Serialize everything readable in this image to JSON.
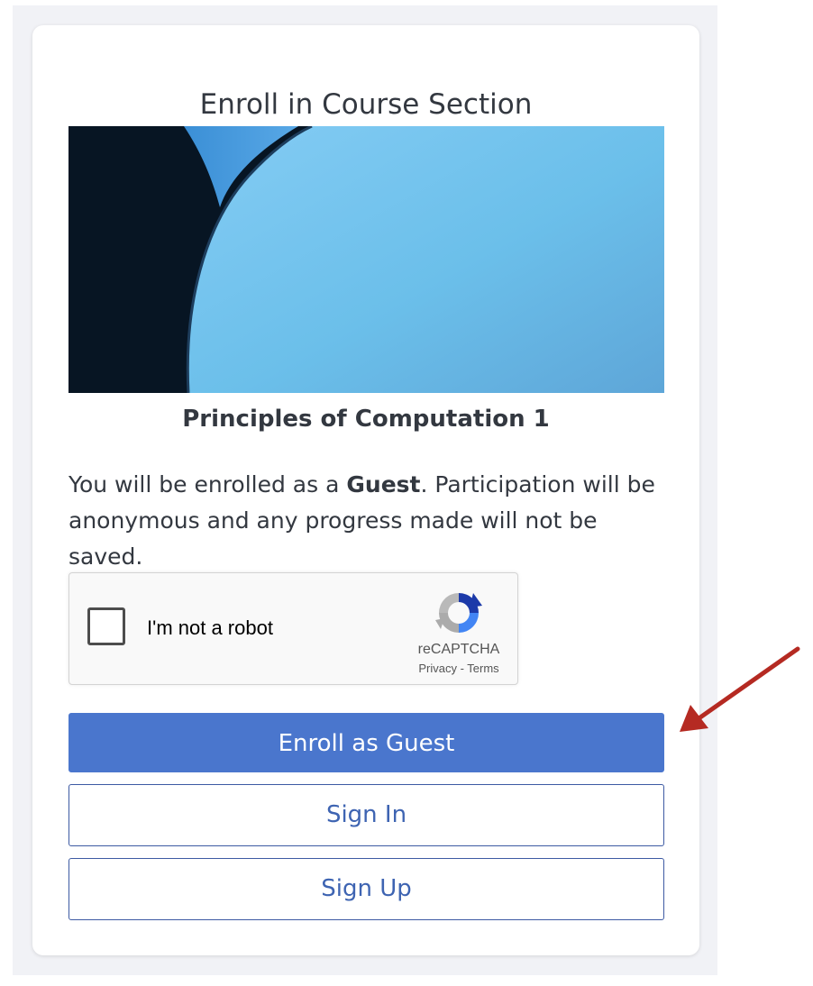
{
  "card": {
    "title": "Enroll in Course Section"
  },
  "course": {
    "name": "Principles of Computation 1"
  },
  "notice": {
    "before": "You will be enrolled as a ",
    "role": "Guest",
    "after": ". Participation will be anonymous and any progress made will not be saved."
  },
  "recaptcha": {
    "checkbox_label": "I'm not a robot",
    "brand": "reCAPTCHA",
    "privacy_link": "Privacy",
    "separator": " - ",
    "terms_link": "Terms",
    "checked": false
  },
  "buttons": {
    "enroll_guest": "Enroll as Guest",
    "sign_in": "Sign In",
    "sign_up": "Sign Up"
  },
  "colors": {
    "primary": "#4a76cd",
    "outline_text": "#3e64b2",
    "annotation_arrow": "#b52a22"
  }
}
